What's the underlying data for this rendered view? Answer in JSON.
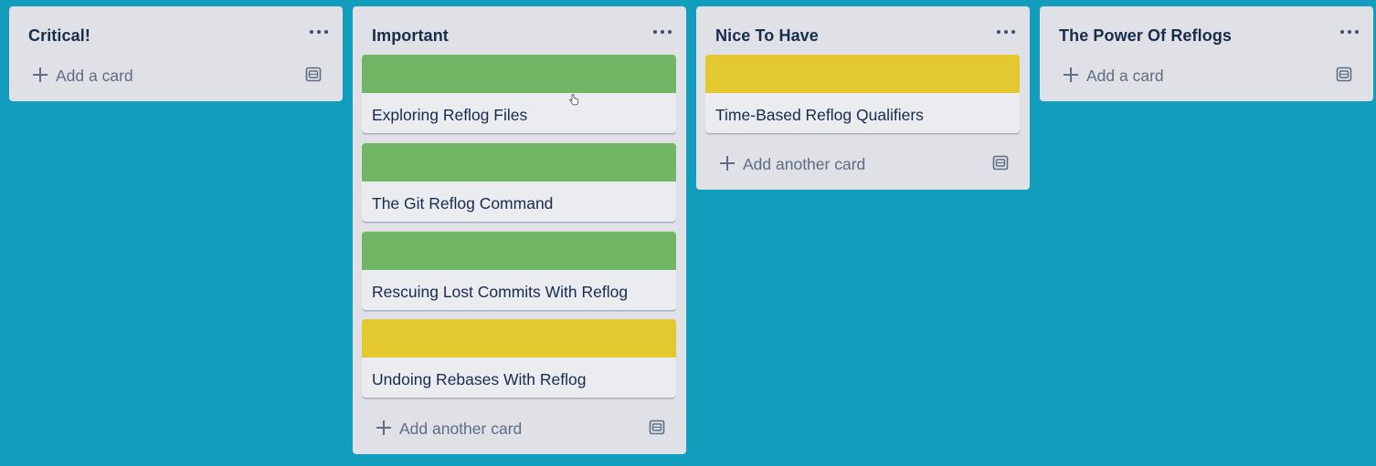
{
  "board": {
    "background_color": "#139dbd",
    "lists": [
      {
        "title": "Critical!",
        "menu_icon": "more-horizontal-icon",
        "cards": [],
        "add_label": "Add a card",
        "template_icon": "card-template-icon"
      },
      {
        "title": "Important",
        "menu_icon": "more-horizontal-icon",
        "cards": [
          {
            "title": "Exploring Reflog Files",
            "cover_color": "#70b665"
          },
          {
            "title": "The Git Reflog Command",
            "cover_color": "#70b665"
          },
          {
            "title": "Rescuing Lost Commits With Reflog",
            "cover_color": "#70b665"
          },
          {
            "title": "Undoing Rebases With Reflog",
            "cover_color": "#e4c82f"
          }
        ],
        "add_label": "Add another card",
        "template_icon": "card-template-icon"
      },
      {
        "title": "Nice To Have",
        "menu_icon": "more-horizontal-icon",
        "cards": [
          {
            "title": "Time-Based Reflog Qualifiers",
            "cover_color": "#e4c82f"
          }
        ],
        "add_label": "Add another card",
        "template_icon": "card-template-icon"
      },
      {
        "title": "The Power Of Reflogs",
        "menu_icon": "more-horizontal-icon",
        "cards": [],
        "add_label": "Add a card",
        "template_icon": "card-template-icon"
      }
    ]
  }
}
